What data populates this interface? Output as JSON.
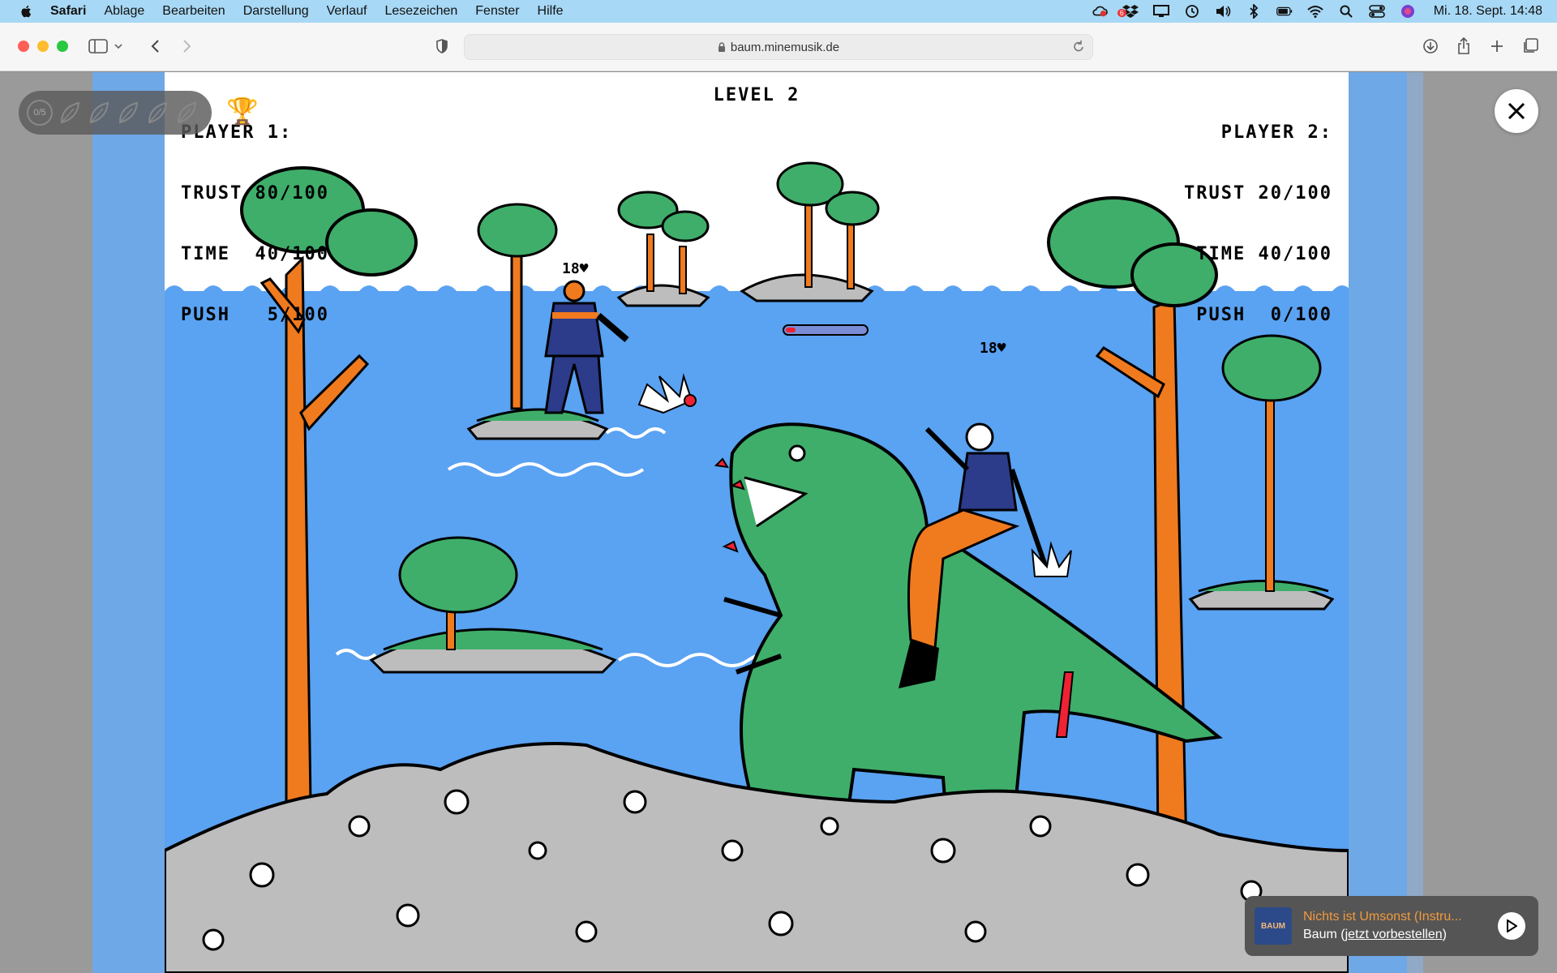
{
  "menubar": {
    "app_name": "Safari",
    "items": [
      "Ablage",
      "Bearbeiten",
      "Darstellung",
      "Verlauf",
      "Lesezeichen",
      "Fenster",
      "Hilfe"
    ],
    "notification_badge": "6",
    "clock": "Mi. 18. Sept.  14:48",
    "status_icons": [
      "cloud-icon",
      "dropbox-icon",
      "display-icon",
      "time-machine-icon",
      "volume-icon",
      "bluetooth-icon",
      "battery-icon",
      "wifi-icon",
      "search-icon",
      "control-center-icon",
      "siri-icon"
    ]
  },
  "browser": {
    "url": "baum.minemusik.de"
  },
  "game": {
    "player1": {
      "label": "PLAYER 1:",
      "trust": "TRUST 80/100",
      "time": "TIME  40/100",
      "push": "PUSH   5/100"
    },
    "player2": {
      "label": "PLAYER 2:",
      "trust": "TRUST 20/100",
      "time": "TIME 40/100",
      "push": "PUSH  0/100"
    },
    "level": "LEVEL 2",
    "hp_left": "18♥",
    "hp_right": "18♥",
    "leaf_progress": "0/5",
    "leaf_total": 5
  },
  "now_playing": {
    "title": "Nichts ist Umsonst (Instru...",
    "artist": "Baum",
    "link_text": "jetzt vorbestellen",
    "cover_text": "BAUM"
  },
  "colors": {
    "sky": "#5aa2f2",
    "tree_green": "#3fae6a",
    "trunk_orange": "#f07a1e",
    "dino_green": "#3fae6a",
    "accent_orange": "#f39a3c"
  }
}
